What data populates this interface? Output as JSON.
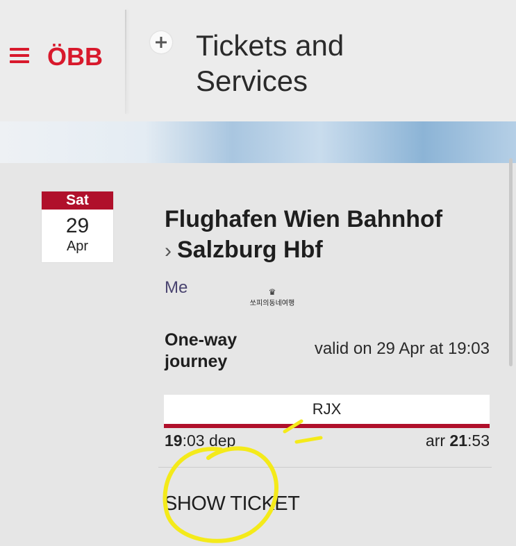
{
  "header": {
    "brand": "ÖBB",
    "title_line1": "Tickets and",
    "title_line2": "Services"
  },
  "ticket": {
    "date": {
      "weekday": "Sat",
      "day": "29",
      "month": "Apr"
    },
    "route": {
      "from": "Flughafen Wien Bahnhof",
      "to": "Salzburg Hbf"
    },
    "traveller": "Me",
    "watermark": "쏘피의동네여행",
    "type": "One-way journey",
    "validity": "valid on 29 Apr at 19:03",
    "train": "RJX",
    "departure": {
      "hour": "19",
      "minute": ":03",
      "label": "dep"
    },
    "arrival": {
      "label": "arr",
      "hour": "21",
      "minute": ":53"
    },
    "action_label": "SHOW TICKET"
  },
  "colors": {
    "brand_red": "#d8192c",
    "accent_red": "#b0102b",
    "annotation_yellow": "#f4ea1a"
  },
  "icons": {
    "menu": "hamburger-icon",
    "add": "plus-icon",
    "chevron": "chevron-right-icon",
    "crown": "crown-icon"
  }
}
